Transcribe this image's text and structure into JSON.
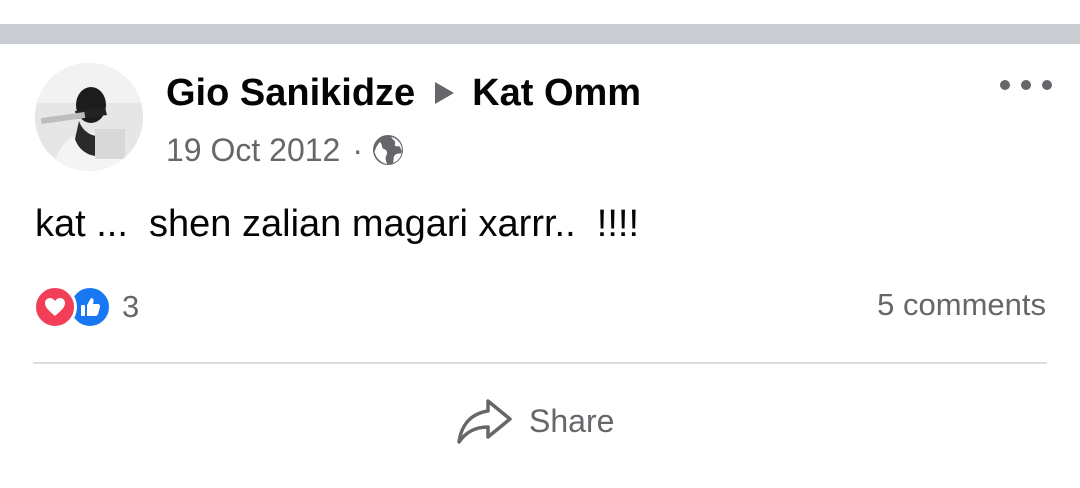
{
  "post": {
    "author": "Gio Sanikidze",
    "target": "Kat Omm",
    "date": "19 Oct 2012",
    "meta_separator": "·",
    "privacy_icon": "globe-icon",
    "text": "kat ...  shen zalian magari xarrr..  !!!!",
    "reactions": {
      "icons": [
        "love-icon",
        "like-icon"
      ],
      "count": "3"
    },
    "comments_label": "5 comments",
    "share_label": "Share",
    "menu_icon": "more-horizontal-icon"
  },
  "colors": {
    "separator": "#c9ccd1",
    "secondary_text": "#65676b",
    "primary_text": "#050505",
    "love": "#f33e58",
    "like": "#1877f2",
    "divider": "#dadde1"
  }
}
